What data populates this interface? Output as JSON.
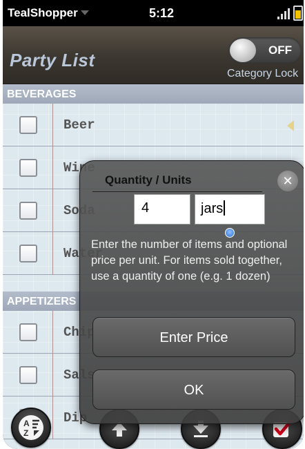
{
  "status_bar": {
    "app_name": "TealShopper",
    "time": "5:12"
  },
  "header": {
    "title": "Party List",
    "category_lock": {
      "state_label": "OFF",
      "label": "Category Lock"
    }
  },
  "list": {
    "sections": [
      {
        "title": "BEVERAGES"
      },
      {
        "title": "APPETIZERS"
      }
    ],
    "items": [
      {
        "name": "Beer",
        "checked": false
      },
      {
        "name": "Wine",
        "checked": false
      },
      {
        "name": "Soda",
        "checked": false
      },
      {
        "name": "Water",
        "checked": false
      },
      {
        "name": "Chips",
        "checked": false
      },
      {
        "name": "Salsa",
        "checked": false
      },
      {
        "name": "Dip",
        "checked": false
      }
    ]
  },
  "command_bar": {
    "buttons": [
      {
        "icon": "sort-az-icon"
      },
      {
        "icon": "arrow-up-icon"
      },
      {
        "icon": "arrow-down-icon"
      },
      {
        "icon": "checkmark-icon"
      }
    ]
  },
  "dialog": {
    "title": "Quantity / Units",
    "quantity_value": "4",
    "units_value": "jars",
    "help_text": "Enter the number of items and optional price per unit. For items sold together, use a quantity of one (e.g. 1 dozen)",
    "enter_price_label": "Enter Price",
    "ok_label": "OK"
  },
  "colors": {
    "header_title": "#b9c7d9",
    "section_header": "#a8b2c2",
    "list_background": "#dde8ef",
    "battery": "#f2c300",
    "check_accent": "#d0021b"
  }
}
